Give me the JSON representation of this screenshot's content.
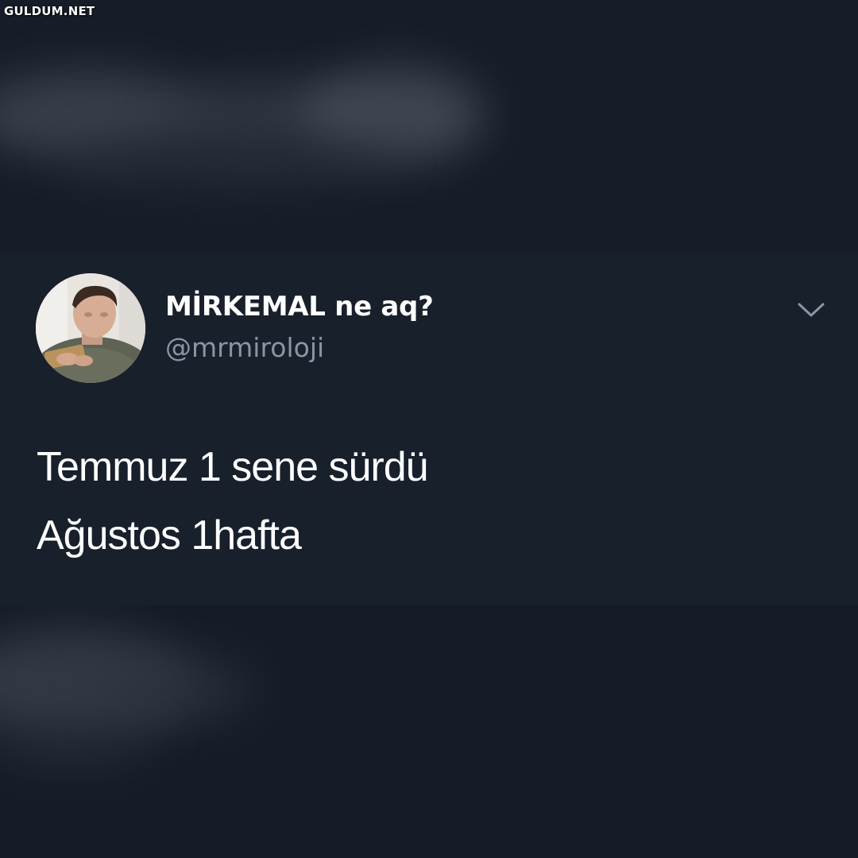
{
  "watermark": "GULDUM.NET",
  "tweet": {
    "display_name": "MİRKEMAL ne aq?",
    "handle": "@mrmiroloji",
    "text_lines": [
      "Temmuz 1 sene sürdü",
      "Ağustos 1hafta"
    ],
    "menu_icon": "chevron-down-icon"
  },
  "colors": {
    "background": "#161c27",
    "tweet_background": "#18202c",
    "name": "#ffffff",
    "handle": "#8796a6",
    "chevron": "#8796a6"
  }
}
